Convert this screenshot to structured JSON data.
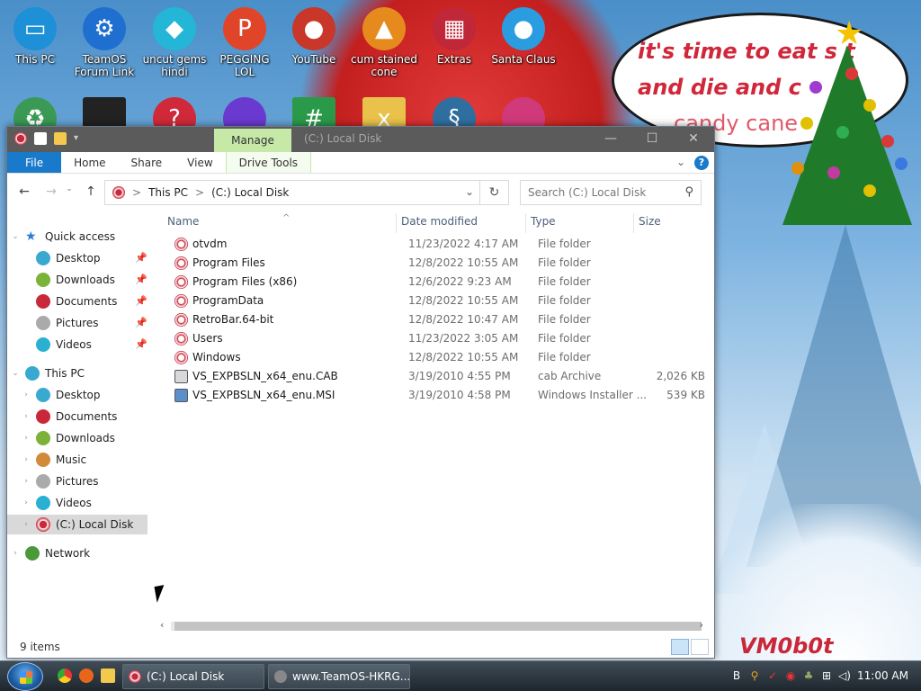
{
  "desktop": {
    "icons": [
      {
        "label": "This PC",
        "color": "#1e90d8",
        "glyph": "▭"
      },
      {
        "label": "TeamOS Forum Link",
        "color": "#1f6fd0",
        "glyph": "⚙"
      },
      {
        "label": "uncut gems hindi",
        "color": "#23b6d6",
        "glyph": "◆"
      },
      {
        "label": "PEGGING LOL",
        "color": "#e0452a",
        "glyph": "P"
      },
      {
        "label": "YouTube",
        "color": "#c9362a",
        "glyph": "●"
      },
      {
        "label": "cum stained cone",
        "color": "#e78a1e",
        "glyph": "▲"
      },
      {
        "label": "Extras",
        "color": "#c0283a",
        "glyph": "▦"
      },
      {
        "label": "Santa Claus",
        "color": "#2a9de0",
        "glyph": "●"
      }
    ],
    "speech_lines": [
      "it's time to eat s  t",
      "and die and c",
      "candy cane"
    ],
    "watermark": "VM0b0t"
  },
  "window": {
    "title": "(C:) Local Disk",
    "manage_tab": "Manage",
    "ribbon_tabs": [
      "File",
      "Home",
      "Share",
      "View",
      "Drive Tools"
    ],
    "help": "?",
    "address": {
      "root": "This PC",
      "separator": ">",
      "current": "(C:) Local Disk"
    },
    "search_placeholder": "Search (C:) Local Disk",
    "columns": {
      "name": "Name",
      "date": "Date modified",
      "type": "Type",
      "size": "Size"
    },
    "files": [
      {
        "name": "otvdm",
        "date": "11/23/2022 4:17 AM",
        "type": "File folder",
        "size": "",
        "icon": "folder"
      },
      {
        "name": "Program Files",
        "date": "12/8/2022 10:55 AM",
        "type": "File folder",
        "size": "",
        "icon": "folder"
      },
      {
        "name": "Program Files (x86)",
        "date": "12/6/2022 9:23 AM",
        "type": "File folder",
        "size": "",
        "icon": "folder"
      },
      {
        "name": "ProgramData",
        "date": "12/8/2022 10:55 AM",
        "type": "File folder",
        "size": "",
        "icon": "folder"
      },
      {
        "name": "RetroBar.64-bit",
        "date": "12/8/2022 10:47 AM",
        "type": "File folder",
        "size": "",
        "icon": "folder"
      },
      {
        "name": "Users",
        "date": "11/23/2022 3:05 AM",
        "type": "File folder",
        "size": "",
        "icon": "folder"
      },
      {
        "name": "Windows",
        "date": "12/8/2022 10:55 AM",
        "type": "File folder",
        "size": "",
        "icon": "folder"
      },
      {
        "name": "VS_EXPBSLN_x64_enu.CAB",
        "date": "3/19/2010 4:55 PM",
        "type": "cab Archive",
        "size": "2,026 KB",
        "icon": "cab"
      },
      {
        "name": "VS_EXPBSLN_x64_enu.MSI",
        "date": "3/19/2010 4:58 PM",
        "type": "Windows Installer ...",
        "size": "539 KB",
        "icon": "msi"
      }
    ],
    "nav": {
      "quick_access": "Quick access",
      "quick_items": [
        "Desktop",
        "Downloads",
        "Documents",
        "Pictures",
        "Videos"
      ],
      "this_pc": "This PC",
      "pc_items": [
        "Desktop",
        "Documents",
        "Downloads",
        "Music",
        "Pictures",
        "Videos",
        "(C:) Local Disk"
      ],
      "network": "Network"
    },
    "status": "9 items"
  },
  "taskbar": {
    "tasks": [
      "(C:) Local Disk",
      "www.TeamOS-HKRG...."
    ],
    "clock": "11:00 AM"
  },
  "colors": {
    "accent": "#1979ca",
    "manage_tab": "#c6e9a8",
    "folder_icon": "#c8283a"
  }
}
